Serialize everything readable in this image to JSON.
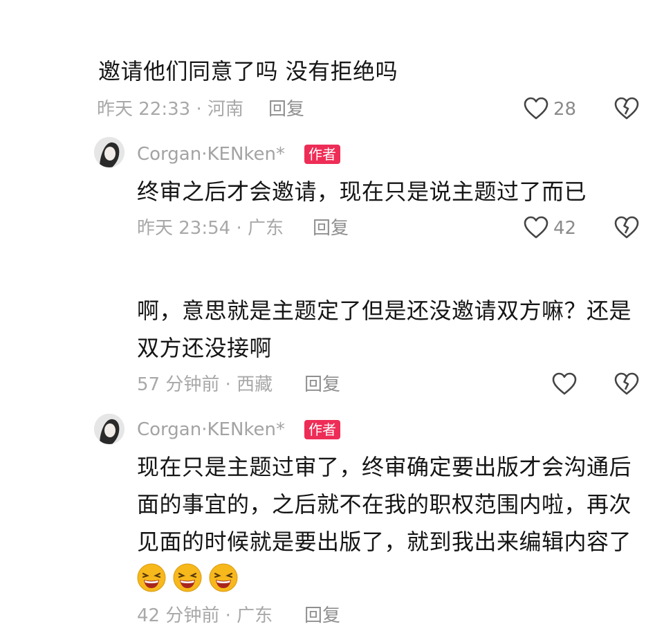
{
  "comment1": {
    "text": "邀请他们同意了吗 没有拒绝吗",
    "time_location": "昨天 22:33 · 河南",
    "reply_label": "回复",
    "like_count": "28",
    "like_icon": "heart-outline-icon",
    "dislike_icon": "broken-heart-icon"
  },
  "reply1": {
    "username": "Corgan·KENken*",
    "badge": "作者",
    "text": "终审之后才会邀请，现在只是说主题过了而已",
    "time_location": "昨天 23:54 · 广东",
    "reply_label": "回复",
    "like_count": "42",
    "like_icon": "heart-outline-icon",
    "dislike_icon": "broken-heart-icon"
  },
  "comment2": {
    "text_line1": "啊，意思就是主题定了但是还没邀请双方嘛？还是",
    "text_line2": "双方还没接啊",
    "time_location": "57 分钟前 · 西藏",
    "reply_label": "回复",
    "like_icon": "heart-outline-icon",
    "dislike_icon": "broken-heart-icon"
  },
  "reply2": {
    "username": "Corgan·KENken*",
    "badge": "作者",
    "text_line1": "现在只是主题过审了，终审确定要出版才会沟通后",
    "text_line2": "面的事宜的，之后就不在我的职权范围内啦，再次",
    "text_line3": "见面的时候就是要出版了，就到我出来编辑内容了",
    "emojis": [
      "laughing-emoji",
      "laughing-emoji",
      "laughing-emoji"
    ],
    "time_location": "42 分钟前 · 广东",
    "reply_label": "回复"
  },
  "colors": {
    "badge": "#ee2d57",
    "text": "#151515",
    "meta": "#a8a8a8"
  }
}
